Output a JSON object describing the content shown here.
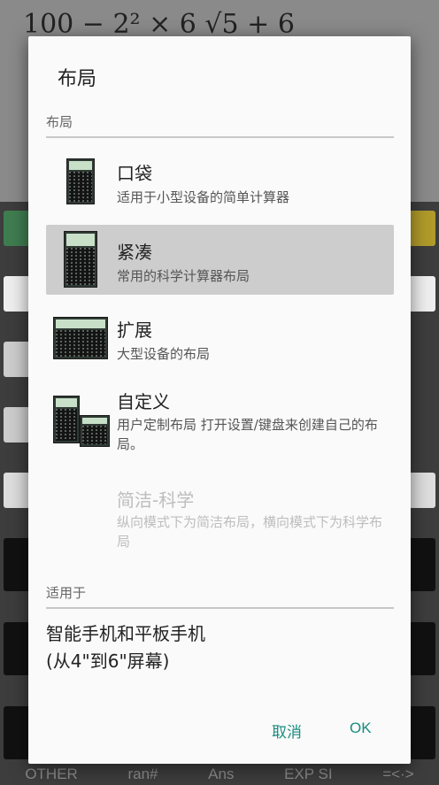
{
  "background": {
    "expression": "100 − 2² × 6 √5 + 6",
    "bottom_keys": [
      "OTHER",
      "ran#",
      "Ans",
      "EXP SI",
      "=<·>"
    ]
  },
  "dialog": {
    "title": "布局",
    "layout_section_label": "布局",
    "options": [
      {
        "title": "口袋",
        "desc": "适用于小型设备的简单计算器",
        "icon": "pocket-calculator-thumbnail"
      },
      {
        "title": "紧凑",
        "desc": "常用的科学计算器布局",
        "icon": "compact-calculator-thumbnail"
      },
      {
        "title": "扩展",
        "desc": "大型设备的布局",
        "icon": "extended-calculator-thumbnail"
      },
      {
        "title": "自定义",
        "desc": "用户定制布局 打开设置/键盘来创建自己的布局。",
        "icon": "custom-calculator-thumbnail"
      },
      {
        "title": "简洁-科学",
        "desc": "纵向模式下为简洁布局，横向模式下为科学布局"
      }
    ],
    "selected_index": 1,
    "applies_section_label": "适用于",
    "applies_line1": "智能手机和平板手机",
    "applies_line2": "(从4\"到6\"屏幕)",
    "cancel_label": "取消",
    "ok_label": "OK"
  },
  "colors": {
    "accent": "#1a8c7e",
    "selected_bg": "#cdcdcd",
    "dialog_bg": "#fafafa"
  }
}
